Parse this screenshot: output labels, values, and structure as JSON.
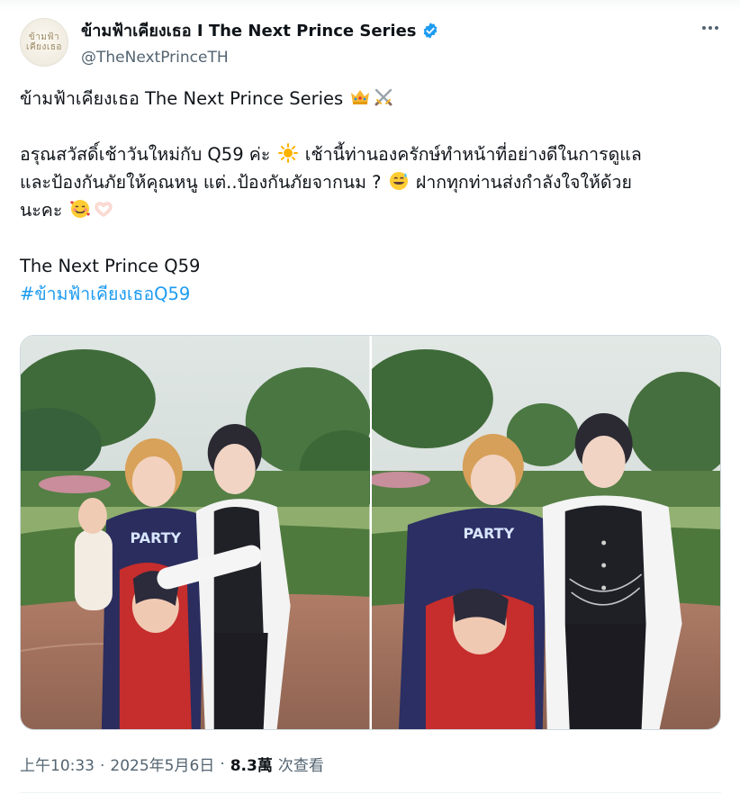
{
  "author": {
    "display_name": "ข้ามฟ้าเคียงเธอ I The Next Prince Series",
    "handle": "@TheNextPrinceTH",
    "avatar_text": "ข้ามฟ้า เคียงเธอ",
    "verified": true,
    "verified_color": "#1d9bf0"
  },
  "tweet": {
    "line1": "ข้ามฟ้าเคียงเธอ The Next Prince Series",
    "line1_emojis": [
      "crown-emoji",
      "crossed-swords-emoji"
    ],
    "line2a": "อรุณสวัสดิ์เช้าวันใหม่กับ Q59 ค่ะ",
    "line2b": "เช้านี้ท่านองครักษ์ทำหน้าที่อย่างดีในการดูแล",
    "line3a": "และป้องกันภัยให้คุณหนู แต่..ป้องกันภัยจากนม ?",
    "line3b": "ฝากทุกท่านส่งกำลังใจให้ด้วย",
    "line4": "นะคะ",
    "line4_emojis": [
      "smiling-face-with-hearts-emoji",
      "heart-hands-emoji"
    ],
    "line5": "The Next Prince Q59",
    "hashtag": "#ข้ามฟ้าเคียงเธอQ59",
    "link_color": "#1d9bf0"
  },
  "media": {
    "photos": [
      "photo-1",
      "photo-2"
    ]
  },
  "meta": {
    "time": "上午10:33",
    "date": "2025年5月6日",
    "separator": "·",
    "views_count": "8.3萬",
    "views_label": "次查看"
  },
  "colors": {
    "text": "#0f1419",
    "secondary": "#536471",
    "border": "#cfd9de"
  }
}
